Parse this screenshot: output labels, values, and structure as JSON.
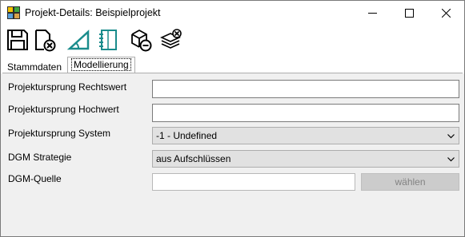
{
  "window": {
    "title": "Projekt-Details: Beispielprojekt",
    "buttons": {
      "minimize": "minimize",
      "maximize": "maximize",
      "close": "close"
    }
  },
  "toolbar": {
    "icons": [
      "save-icon",
      "close-document-icon",
      "slope-icon",
      "notebook-icon",
      "remove-cube-icon",
      "clear-layers-icon"
    ]
  },
  "tabs": [
    {
      "label": "Stammdaten",
      "active": false
    },
    {
      "label": "Modellierung",
      "active": true
    }
  ],
  "form": {
    "rechtswert": {
      "label": "Projektursprung Rechtswert",
      "value": ""
    },
    "hochwert": {
      "label": "Projektursprung Hochwert",
      "value": ""
    },
    "system": {
      "label": "Projektursprung System",
      "selected": "-1 - Undefined"
    },
    "strategie": {
      "label": "DGM Strategie",
      "selected": "aus Aufschlüssen"
    },
    "quelle": {
      "label": "DGM-Quelle",
      "value": "",
      "button_label": "wählen"
    }
  },
  "colors": {
    "panel_bg": "#f0f0f0",
    "combo_bg": "#e1e1e1",
    "disabled_button_text": "#838383",
    "icon_teal": "#1a8c8c"
  }
}
